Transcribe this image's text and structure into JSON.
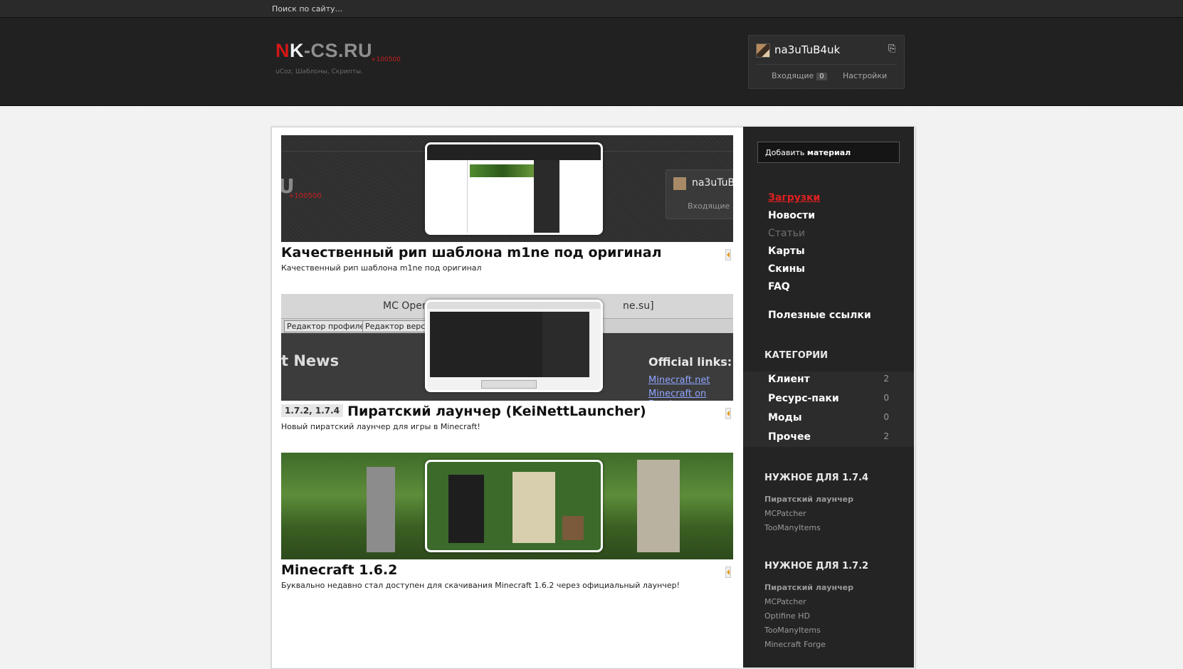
{
  "search": {
    "placeholder": "Поиск по сайту..."
  },
  "logo": {
    "n": "N",
    "k": "K",
    "rest": "-CS.RU",
    "score": "+100500",
    "tagline": "uCoz, Шаблоны, Скрипты."
  },
  "user": {
    "name": "na3uTuB4uk",
    "inbox_label": "Входящие",
    "inbox_count": "0",
    "settings_label": "Настройки"
  },
  "posts": [
    {
      "title": "Качественный рип шаблона m1ne под оригинал",
      "description": "Качественный рип шаблона m1ne под оригинал",
      "thumb": {
        "score": "+100500",
        "user": "na3uTuB",
        "inbox": "Входящие"
      }
    },
    {
      "version": "1.7.2, 1.7.4",
      "title": "Пиратский лаунчер (KeiNettLauncher)",
      "description": "Новый пиратский лаунчер для игры в Minecraft!",
      "thumb": {
        "header": "MC Oper",
        "header_right": "ne.su]",
        "tab1": "Редактор профилей",
        "tab2": "Редактор верси",
        "news": "t News",
        "official": "Official links:",
        "link1": "Minecraft.net",
        "link2": "Minecraft on Faceb"
      }
    },
    {
      "title": "Minecraft 1.6.2",
      "description": "Буквально недавно стал доступен для скачивания Minecraft 1.6.2 через официальный лаунчер!"
    }
  ],
  "sidebar": {
    "add_button_prefix": "Добавить ",
    "add_button_bold": "материал",
    "nav": [
      "Загрузки",
      "Новости",
      "Статьи",
      "Карты",
      "Скины",
      "FAQ"
    ],
    "useful_links": "Полезные ссылки",
    "categories_heading": "КАТЕГОРИИ",
    "categories": [
      {
        "name": "Клиент",
        "count": "2"
      },
      {
        "name": "Ресурс-паки",
        "count": "0"
      },
      {
        "name": "Моды",
        "count": "0"
      },
      {
        "name": "Прочее",
        "count": "2"
      }
    ],
    "need_174_heading": "НУЖНОЕ ДЛЯ 1.7.4",
    "need_174": [
      "Пиратский лаунчер",
      "MCPatcher",
      "TooManyItems"
    ],
    "need_172_heading": "НУЖНОЕ ДЛЯ 1.7.2",
    "need_172": [
      "Пиратский лаунчер",
      "MCPatcher",
      "Optifine HD",
      "TooManyItems",
      "Minecraft Forge"
    ]
  },
  "colors": {
    "accent_red": "#d41717",
    "sidebar_bg": "#242424",
    "header_bg": "#1f1f1f"
  }
}
